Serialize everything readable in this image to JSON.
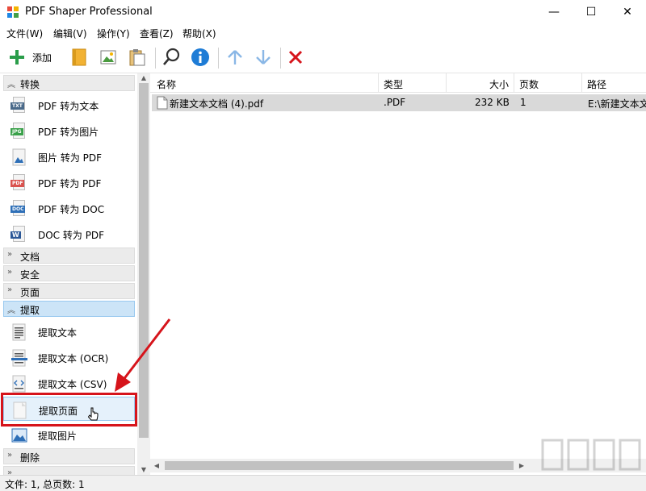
{
  "window": {
    "title": "PDF Shaper Professional",
    "minimize": "—",
    "maximize": "☐",
    "close": "✕"
  },
  "menu": [
    "文件(W)",
    "编辑(V)",
    "操作(Y)",
    "查看(Z)",
    "帮助(X)"
  ],
  "toolbar": {
    "add_label": "添加"
  },
  "sidebar": {
    "groups": [
      {
        "label": "转换",
        "items": [
          "PDF 转为文本",
          "PDF 转为图片",
          "图片 转为 PDF",
          "PDF 转为 PDF",
          "PDF 转为 DOC",
          "DOC 转为 PDF"
        ]
      },
      {
        "label": "文档"
      },
      {
        "label": "安全"
      },
      {
        "label": "页面"
      },
      {
        "label": "提取",
        "items": [
          "提取文本",
          "提取文本 (OCR)",
          "提取文本 (CSV)",
          "提取页面",
          "提取图片"
        ]
      },
      {
        "label": "删除"
      }
    ],
    "icon_tags": {
      "txt": "TXT",
      "jpg": "JPG",
      "pdf": "PDF",
      "doc": "DOC",
      "word": "W"
    }
  },
  "table": {
    "columns": [
      "名称",
      "类型",
      "大小",
      "页数",
      "路径"
    ],
    "rows": [
      {
        "name": "新建文本文档 (4).pdf",
        "type": ".PDF",
        "size": "232 KB",
        "pages": "1",
        "path": "E:\\新建文本文"
      }
    ]
  },
  "status": {
    "text": "文件: 1, 总页数: 1"
  },
  "colors": {
    "accent_red": "#d6141b",
    "selection_blue": "#cce4f7",
    "toolbar_green": "#2a9d4a",
    "toolbar_blue": "#1e7cd6"
  }
}
